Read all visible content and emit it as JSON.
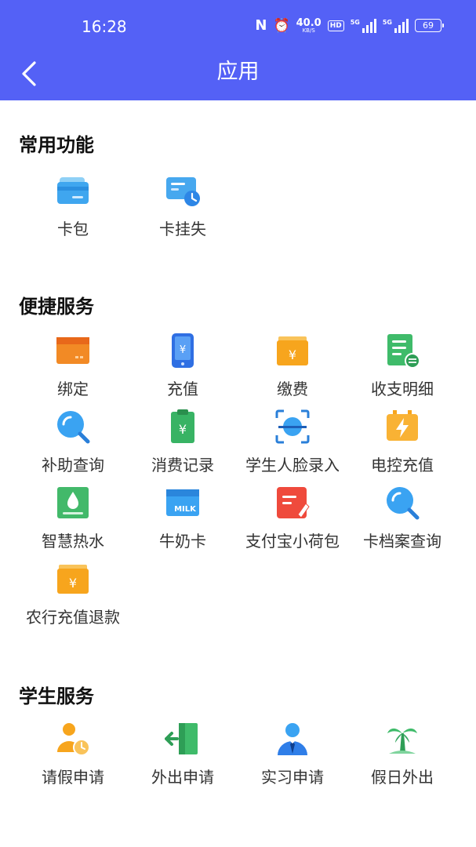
{
  "status_bar": {
    "time": "16:28",
    "nfc": "N",
    "net_speed": "40.0",
    "net_unit": "KB/S",
    "hd": "HD",
    "sig1": "5G",
    "sig2": "5G",
    "battery": "69"
  },
  "header": {
    "title": "应用",
    "accent_color": "#5461f6"
  },
  "sections": [
    {
      "title": "常用功能",
      "items": [
        {
          "label": "卡包",
          "icon": "wallet-card-icon"
        },
        {
          "label": "卡挂失",
          "icon": "card-report-loss-icon"
        }
      ]
    },
    {
      "title": "便捷服务",
      "items": [
        {
          "label": "绑定",
          "icon": "bind-card-icon"
        },
        {
          "label": "充值",
          "icon": "phone-recharge-icon"
        },
        {
          "label": "缴费",
          "icon": "payment-icon"
        },
        {
          "label": "收支明细",
          "icon": "statement-icon"
        },
        {
          "label": "补助查询",
          "icon": "subsidy-search-icon"
        },
        {
          "label": "消费记录",
          "icon": "consumption-record-icon"
        },
        {
          "label": "学生人脸录入",
          "icon": "face-scan-icon"
        },
        {
          "label": "电控充值",
          "icon": "electricity-recharge-icon"
        },
        {
          "label": "智慧热水",
          "icon": "hot-water-icon"
        },
        {
          "label": "牛奶卡",
          "icon": "milk-card-icon"
        },
        {
          "label": "支付宝小荷包",
          "icon": "alipay-wallet-icon"
        },
        {
          "label": "卡档案查询",
          "icon": "card-archive-search-icon"
        },
        {
          "label": "农行充值退款",
          "icon": "abc-refund-icon"
        }
      ]
    },
    {
      "title": "学生服务",
      "items": [
        {
          "label": "请假申请",
          "icon": "leave-request-icon"
        },
        {
          "label": "外出申请",
          "icon": "go-out-request-icon"
        },
        {
          "label": "实习申请",
          "icon": "internship-request-icon"
        },
        {
          "label": "假日外出",
          "icon": "holiday-outing-icon"
        }
      ]
    }
  ]
}
